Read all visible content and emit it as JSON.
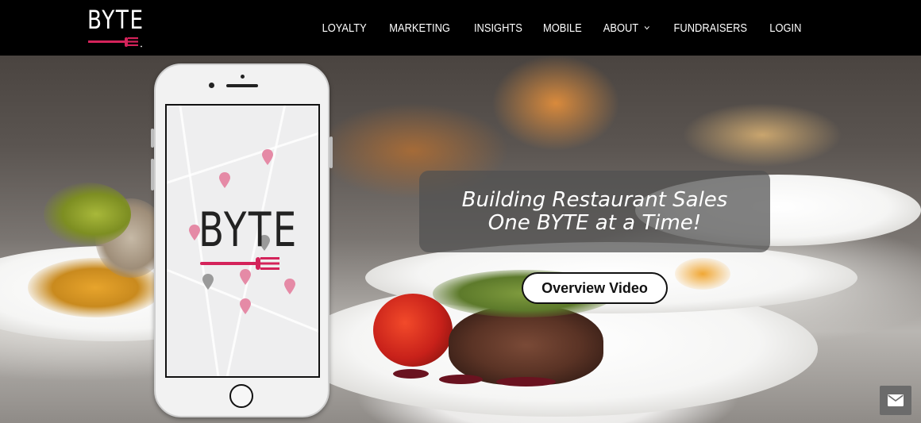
{
  "brand": {
    "logo_text": "BYTE",
    "accent_color": "#d4235a"
  },
  "nav": {
    "items": [
      {
        "label": "LOYALTY"
      },
      {
        "label": "MARKETING"
      },
      {
        "label": "INSIGHTS"
      },
      {
        "label": "MOBILE"
      },
      {
        "label": "ABOUT"
      },
      {
        "label": "FUNDRAISERS"
      },
      {
        "label": "LOGIN"
      }
    ],
    "about_has_dropdown_icon": "chevron-down-icon"
  },
  "hero": {
    "tagline_line1": "Building Restaurant Sales",
    "tagline_line2": "One BYTE at a Time!",
    "cta_label": "Overview Video"
  },
  "phone": {
    "screen_logo_text": "BYTE"
  },
  "widgets": {
    "mail_icon": "envelope-icon"
  }
}
